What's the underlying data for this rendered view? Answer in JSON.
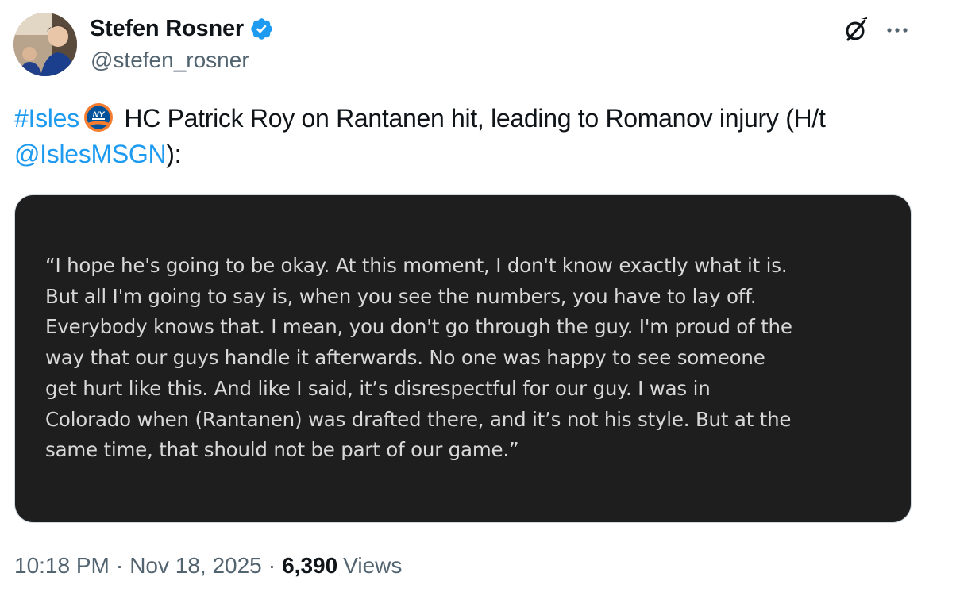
{
  "author": {
    "display_name": "Stefen Rosner",
    "handle": "@stefen_rosner",
    "verified": true,
    "verified_color": "#1d9bf0"
  },
  "icons": {
    "verified": "verified-badge-icon",
    "grok": "grok-icon",
    "more": "more-options-icon",
    "team_logo": "islanders-logo-icon"
  },
  "tweet": {
    "hashtag": "#Isles",
    "text_main": " HC Patrick Roy on Rantanen hit, leading to Romanov injury (H/t ",
    "mention": "@IslesMSGN",
    "text_end": "):"
  },
  "media": {
    "quote_text": "“I hope he's going to be okay. At this moment, I don't know exactly what it is.\nBut all I'm going to say is, when you see the numbers, you have to lay off.\nEverybody knows that. I mean, you don't go through the guy. I'm proud of the\nway that our guys handle it afterwards. No one was happy to see someone\nget hurt like this. And like I said, it’s disrespectful for our guy. I was in\nColorado when (Rantanen) was drafted there, and it’s not his style. But at the\nsame time, that should not be part of our game.”",
    "background_color": "#1e1e1e"
  },
  "meta": {
    "time": "10:18 PM",
    "separator": "·",
    "date": "Nov 18, 2025",
    "views_count": "6,390",
    "views_label": "Views"
  },
  "colors": {
    "link": "#1d9bf0",
    "secondary_text": "#536471",
    "primary_text": "#0f1419"
  }
}
